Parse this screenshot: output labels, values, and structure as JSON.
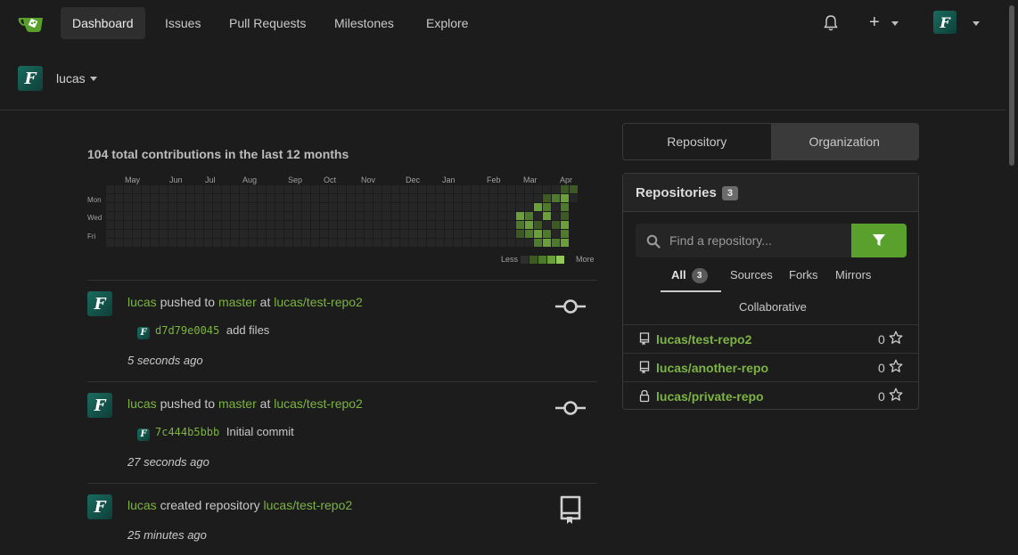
{
  "nav": {
    "items": [
      "Dashboard",
      "Issues",
      "Pull Requests",
      "Milestones",
      "Explore"
    ],
    "active": "Dashboard",
    "plus_label": "+"
  },
  "avatar_letter": "F",
  "context": {
    "user": "lucas"
  },
  "heatmap": {
    "title": "104 total contributions in the last 12 months",
    "months": [
      "May",
      "Jun",
      "Jul",
      "Aug",
      "Sep",
      "Oct",
      "Nov",
      "Dec",
      "Jan",
      "Feb",
      "Mar",
      "Apr"
    ],
    "days": [
      "Mon",
      "Wed",
      "Fri"
    ],
    "legend_less": "Less",
    "legend_more": "More",
    "colors": [
      "#262626",
      "#3d5a22",
      "#4e7a2c",
      "#6a9f3a",
      "#94c85a"
    ]
  },
  "feed": [
    {
      "user": "lucas",
      "action": "pushed to",
      "branch": "master",
      "at": "at",
      "repo": "lucas/test-repo2",
      "commit_sha": "d7d79e0045",
      "commit_msg": "add files",
      "time": "5 seconds ago",
      "icon": "commit-icon"
    },
    {
      "user": "lucas",
      "action": "pushed to",
      "branch": "master",
      "at": "at",
      "repo": "lucas/test-repo2",
      "commit_sha": "7c444b5bbb",
      "commit_msg": "Initial commit",
      "time": "27 seconds ago",
      "icon": "commit-icon"
    },
    {
      "user": "lucas",
      "action": "created repository",
      "repo": "lucas/test-repo2",
      "time": "25 minutes ago",
      "icon": "repo-book-icon"
    }
  ],
  "panel": {
    "tabs": [
      "Repository",
      "Organization"
    ],
    "active_tab": "Organization",
    "title": "Repositories",
    "count": "3",
    "search_placeholder": "Find a repository...",
    "subtabs": [
      "All",
      "Sources",
      "Forks",
      "Mirrors",
      "Collaborative"
    ],
    "all_count": "3",
    "repos": [
      {
        "name": "lucas/test-repo2",
        "stars": "0",
        "icon": "repo-icon"
      },
      {
        "name": "lucas/another-repo",
        "stars": "0",
        "icon": "repo-icon"
      },
      {
        "name": "lucas/private-repo",
        "stars": "0",
        "icon": "lock-icon"
      }
    ],
    "accent": "#5aa02c",
    "link_color": "#7cb342"
  }
}
